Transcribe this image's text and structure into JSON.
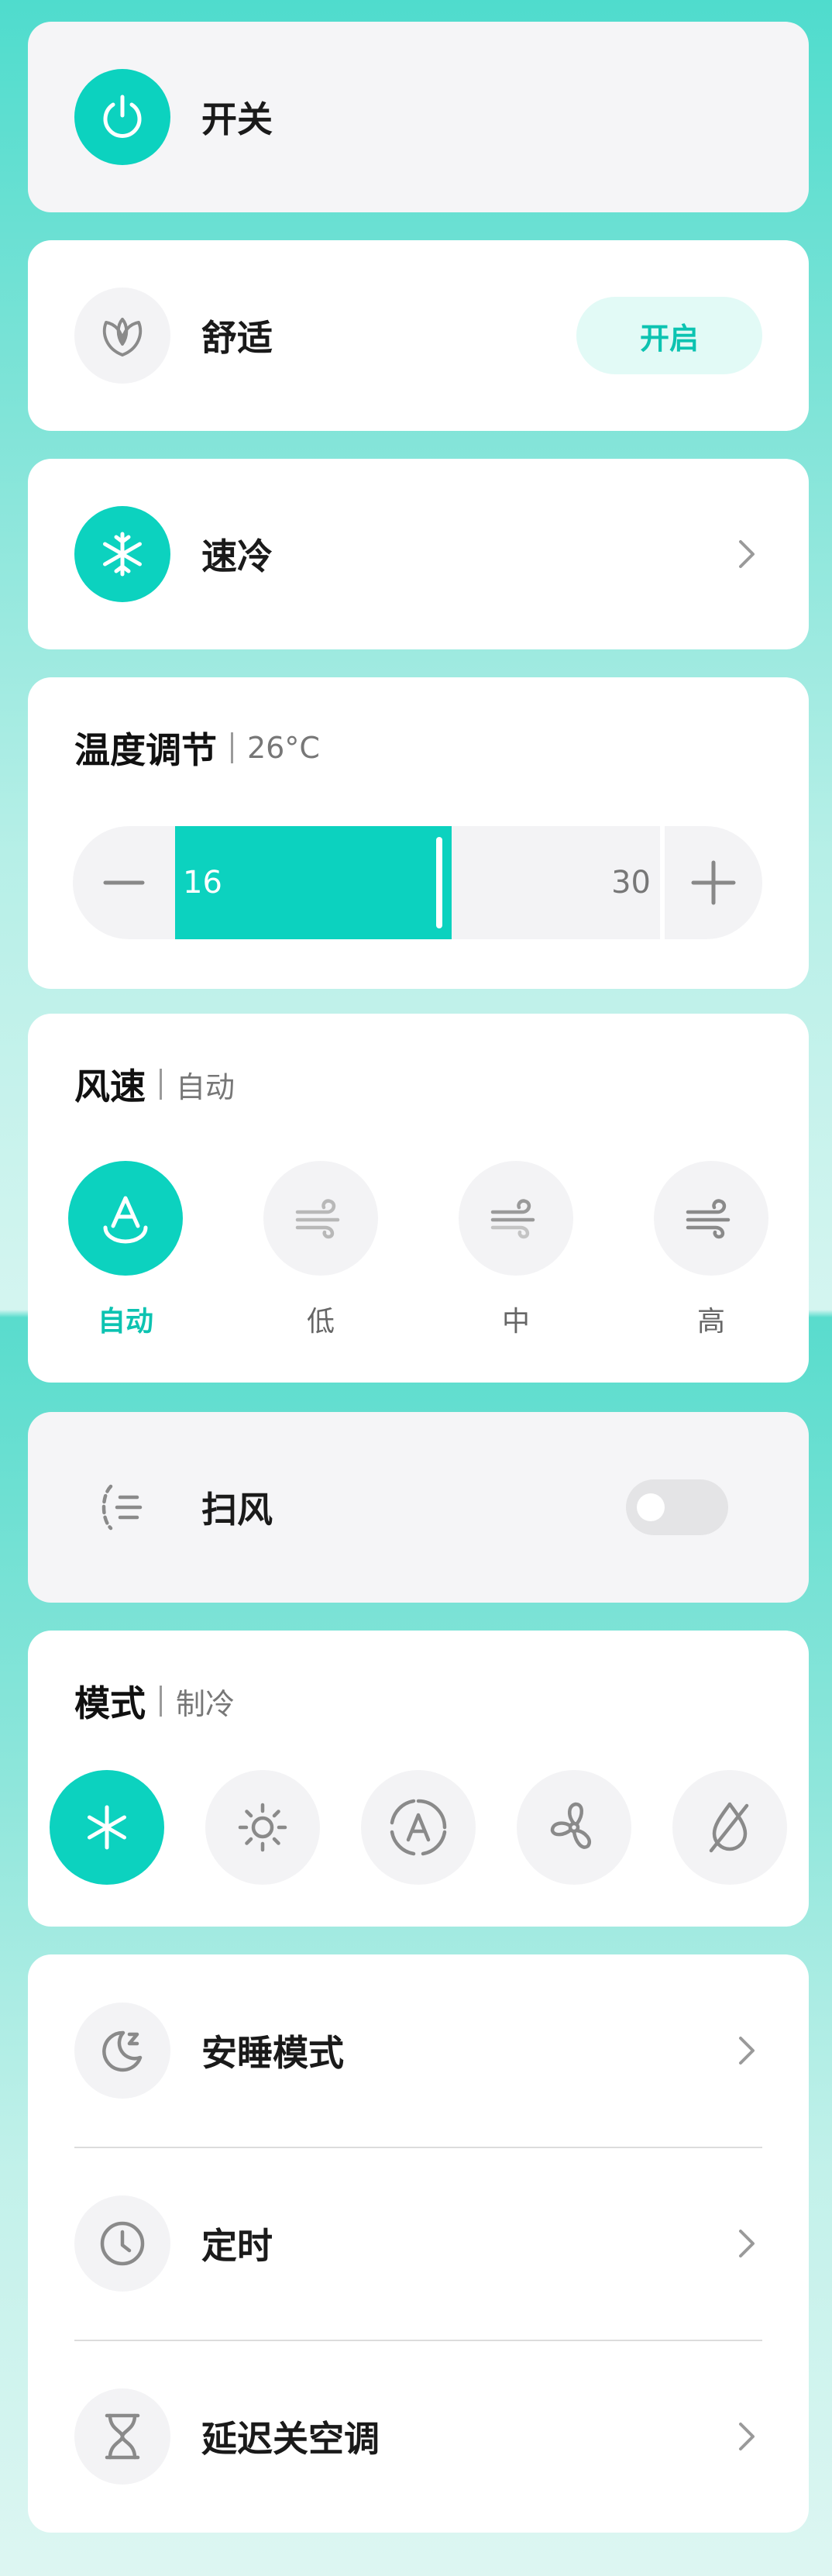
{
  "power": {
    "label": "开关"
  },
  "comfort": {
    "label": "舒适",
    "button_label": "开启"
  },
  "quick_cool": {
    "label": "速冷"
  },
  "temperature": {
    "title": "温度调节",
    "current": "26°C",
    "min_label": "16",
    "max_label": "30",
    "level": 0.57
  },
  "fan_speed": {
    "title": "风速",
    "current": "自动",
    "options": [
      {
        "label": "自动",
        "icon": "auto-fan-icon",
        "active": true
      },
      {
        "label": "低",
        "icon": "wind-low-icon",
        "active": false
      },
      {
        "label": "中",
        "icon": "wind-medium-icon",
        "active": false
      },
      {
        "label": "高",
        "icon": "wind-high-icon",
        "active": false
      }
    ]
  },
  "swing": {
    "label": "扫风",
    "enabled": false
  },
  "mode": {
    "title": "模式",
    "current": "制冷",
    "options": [
      {
        "icon": "snowflake-icon",
        "active": true
      },
      {
        "icon": "sun-icon",
        "active": false
      },
      {
        "icon": "auto-mode-icon",
        "active": false
      },
      {
        "icon": "fan-icon",
        "active": false
      },
      {
        "icon": "dehumidify-icon",
        "active": false
      }
    ]
  },
  "settings": [
    {
      "label": "安睡模式",
      "icon": "moon-sleep-icon"
    },
    {
      "label": "定时",
      "icon": "clock-icon"
    },
    {
      "label": "延迟关空调",
      "icon": "hourglass-icon"
    }
  ],
  "colors": {
    "accent": "#0cd2bf",
    "accent_text": "#0cc3b1",
    "accent_light": "#e2faf6"
  }
}
